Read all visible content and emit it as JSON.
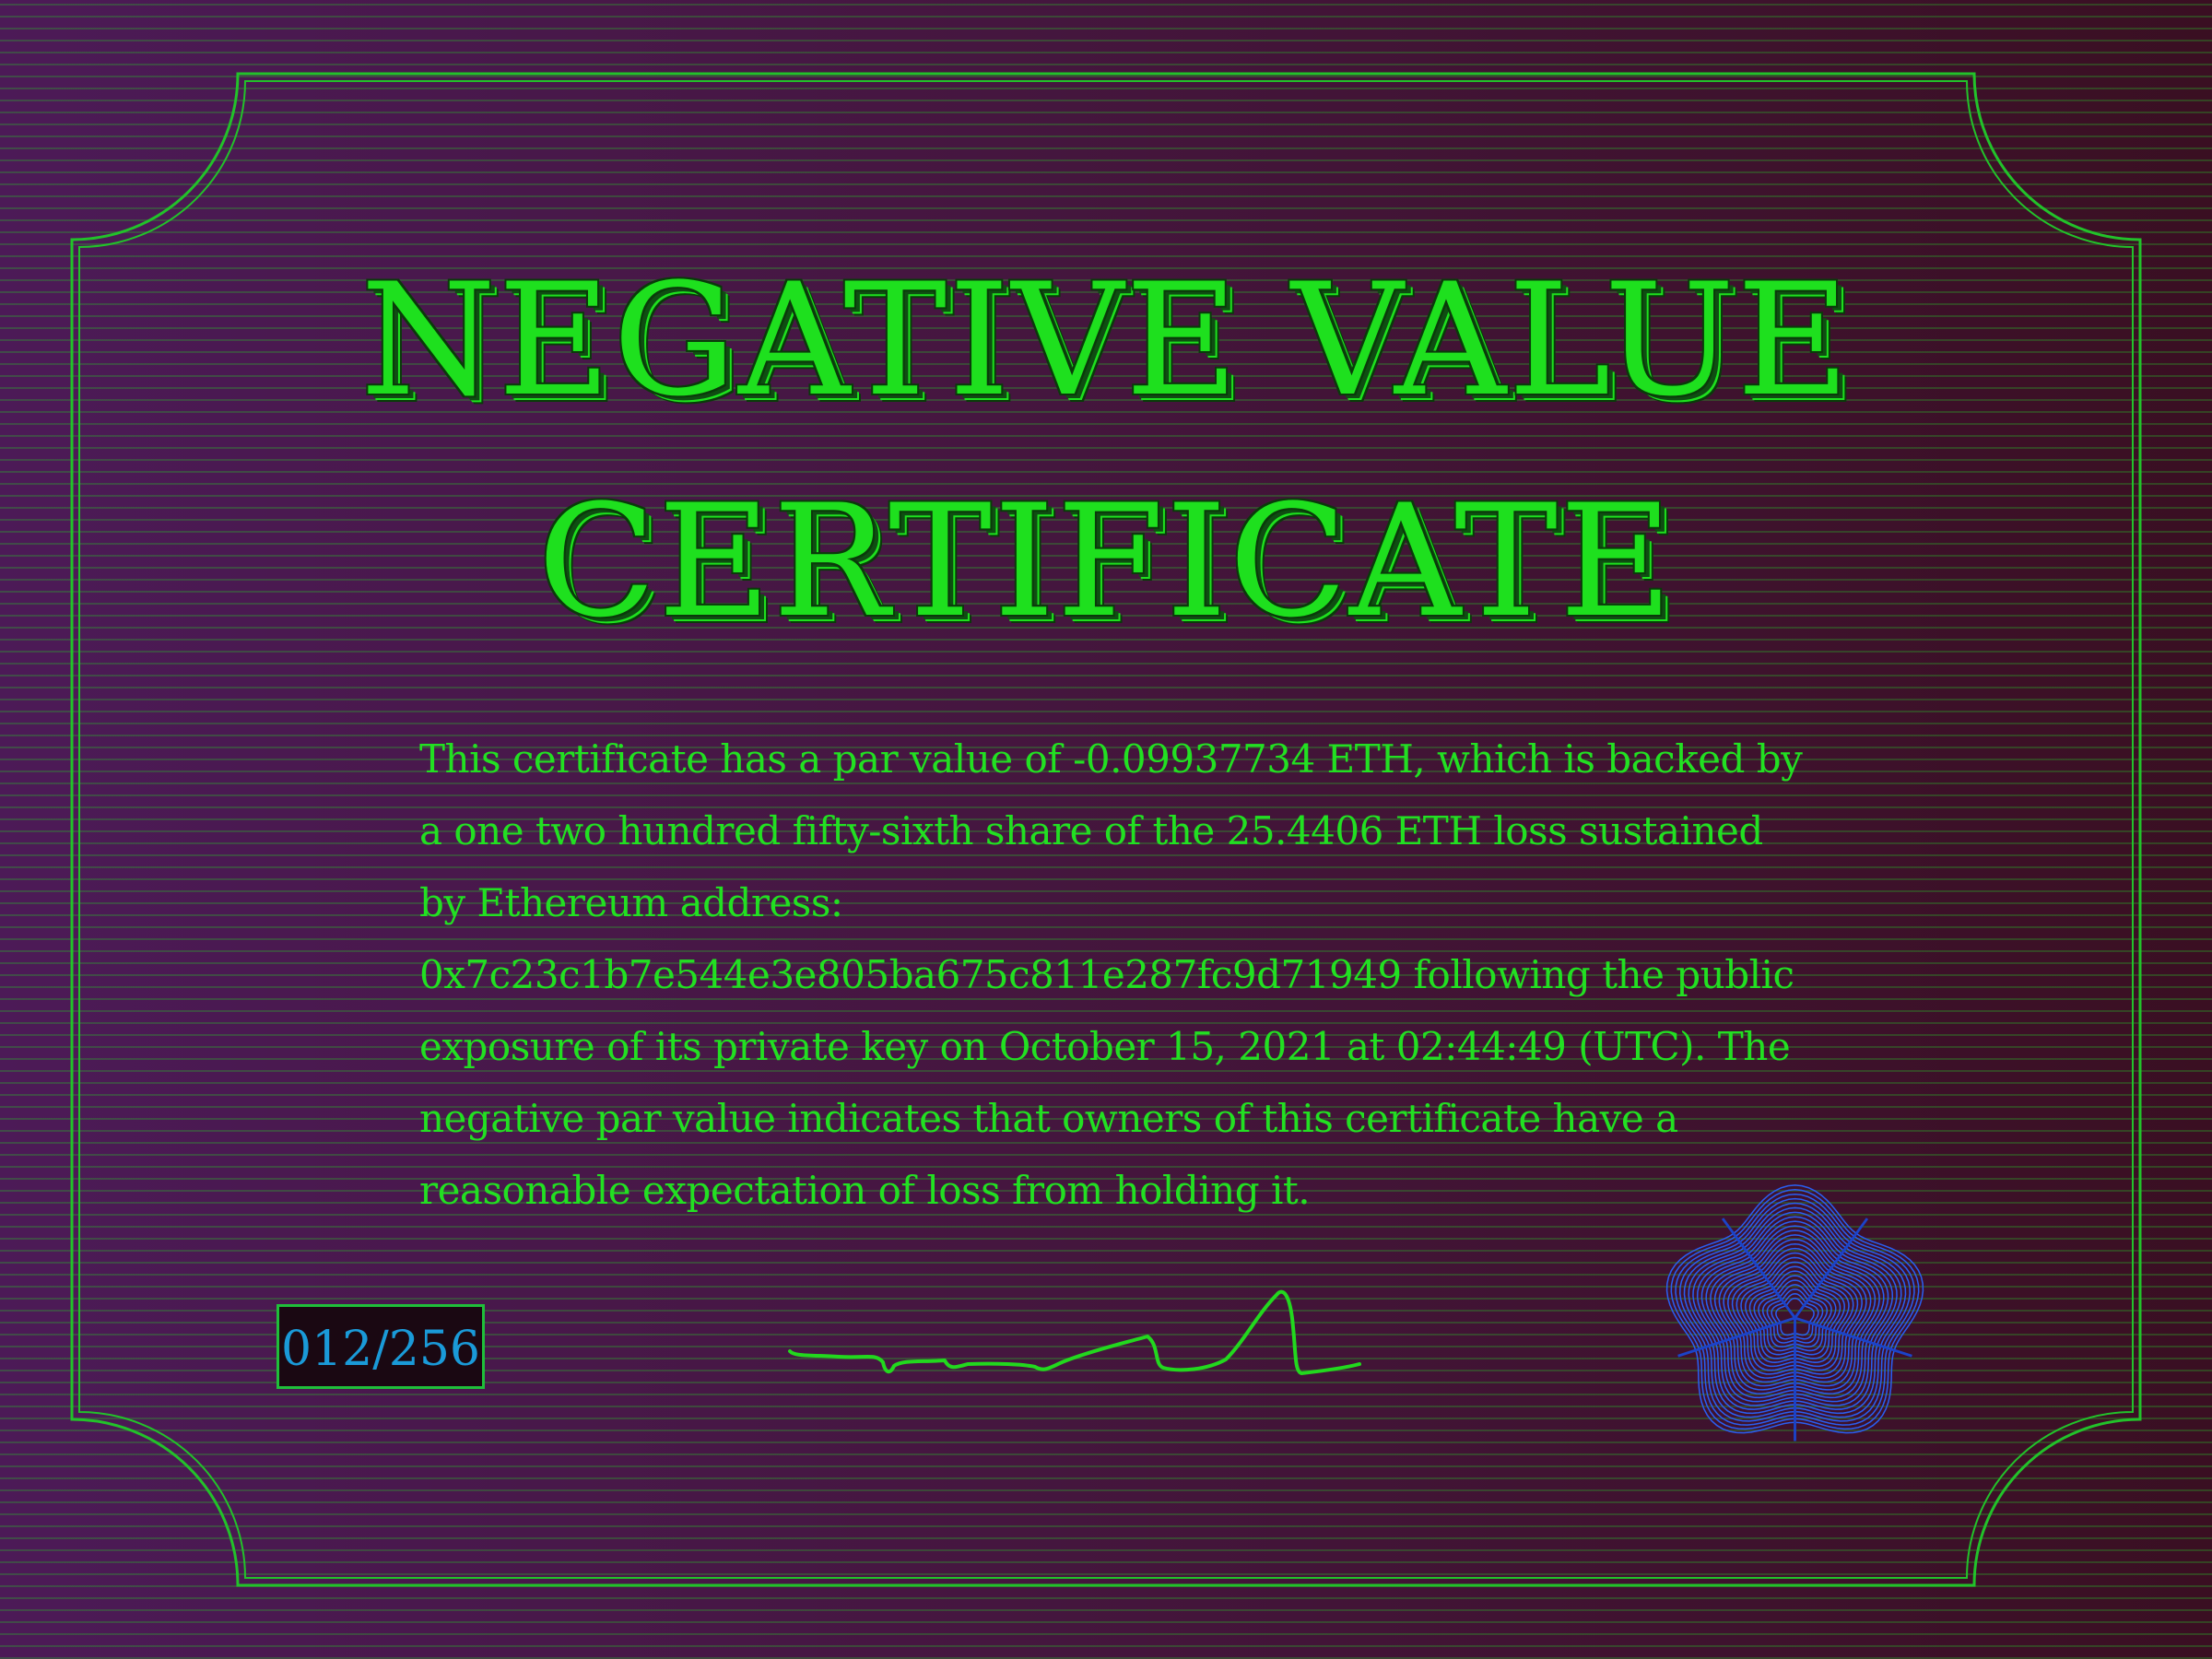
{
  "certificate": {
    "title_line1": "NEGATIVE VALUE",
    "title_line2": "CERTIFICATE",
    "body": "This certificate has a par value of -0.09937734 ETH, which is backed by a  one two hundred fifty-sixth  share of the 25.4406 ETH loss sustained by Ethereum address:  0x7c23c1b7e544e3e805ba675c811e287fc9d71949 following the public exposure of its private key on  October 15, 2021  at 02:44:49 (UTC).  The negative  par value  indicates that owners  of  this certificate have a reasonable expectation of loss from holding it.",
    "serial_number": "012/256"
  },
  "colors": {
    "text_green": "#22e022",
    "frame_green": "#22c22a",
    "serial_blue": "#1a9ad8",
    "seal_blue": "#2a5ef0",
    "background_purple": "#45163f"
  },
  "icons": {
    "seal": "rosette-seal-icon",
    "signature": "handwritten-signature"
  }
}
